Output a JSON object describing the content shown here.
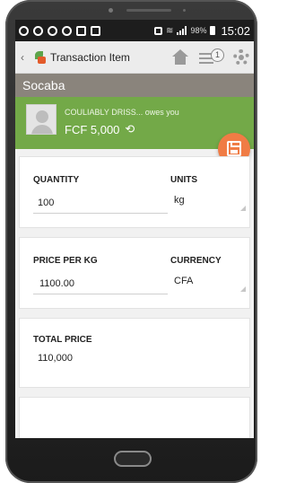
{
  "status_bar": {
    "battery": "98%",
    "time": "15:02"
  },
  "app_bar": {
    "back": "‹",
    "title": "Transaction Item",
    "notification_count": "1",
    "icons": [
      "back-icon",
      "app-logo-icon",
      "home-icon",
      "notifications-icon",
      "gear-icon"
    ]
  },
  "farmer": {
    "name": "Socaba"
  },
  "debt": {
    "text": "COULIABLY DRISS... owes you",
    "amount": "FCF 5,000",
    "refresh_glyph": "⟲"
  },
  "quantity_card": {
    "quantity_label": "QUANTITY",
    "quantity_value": "100",
    "units_label": "UNITS",
    "units_value": "kg"
  },
  "price_card": {
    "price_label": "PRICE PER KG",
    "price_value": "1100.00",
    "currency_label": "CURRENCY",
    "currency_value": "CFA"
  },
  "total_card": {
    "total_label": "TOTAL PRICE",
    "total_value": "110,000"
  },
  "colors": {
    "banner_green": "#73a948",
    "header_brown": "#8a847c",
    "fab_orange": "#f07c45"
  }
}
